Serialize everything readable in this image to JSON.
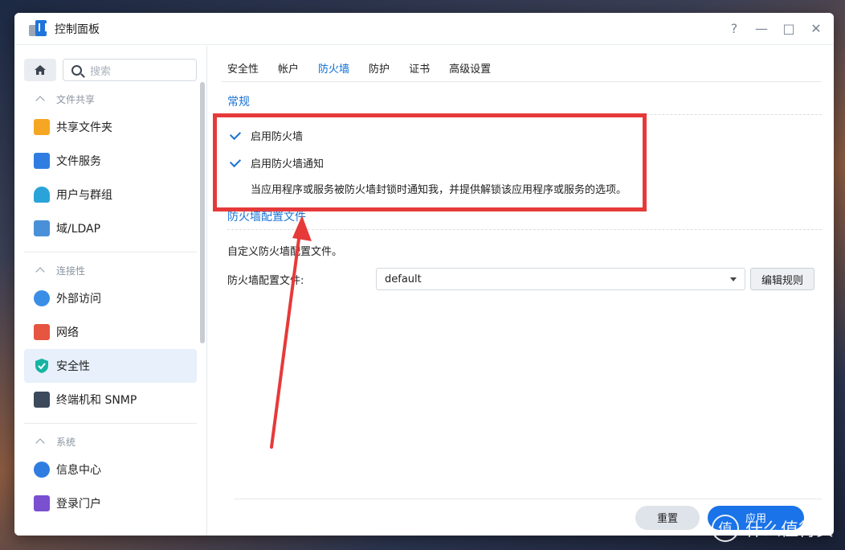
{
  "window": {
    "title": "控制面板",
    "controls": [
      "?",
      "—",
      "□",
      "✕"
    ]
  },
  "sidebar": {
    "search_placeholder": "搜索",
    "groups": [
      {
        "label": "文件共享",
        "items": [
          "共享文件夹",
          "文件服务",
          "用户与群组",
          "域/LDAP"
        ]
      },
      {
        "label": "连接性",
        "items": [
          "外部访问",
          "网络",
          "安全性",
          "终端机和 SNMP"
        ]
      },
      {
        "label": "系统",
        "items": [
          "信息中心",
          "登录门户"
        ]
      }
    ],
    "active_item": "安全性"
  },
  "tabs": [
    "安全性",
    "帐户",
    "防火墙",
    "防护",
    "证书",
    "高级设置"
  ],
  "active_tab": "防火墙",
  "general": {
    "title": "常规",
    "enable_firewall": "启用防火墙",
    "enable_notify": "启用防火墙通知",
    "notify_desc": "当应用程序或服务被防火墙封锁时通知我，并提供解锁该应用程序或服务的选项。"
  },
  "profile": {
    "title": "防火墙配置文件",
    "desc": "自定义防火墙配置文件。",
    "label": "防火墙配置文件:",
    "value": "default",
    "edit_rules": "编辑规则"
  },
  "footer": {
    "reset": "重置",
    "apply": "应用"
  },
  "watermark": {
    "logo": "值",
    "text": "什么值得买"
  },
  "colors": {
    "accent": "#1a73d4",
    "highlight": "#e63a3a",
    "active_bg": "#e7f0fb"
  }
}
